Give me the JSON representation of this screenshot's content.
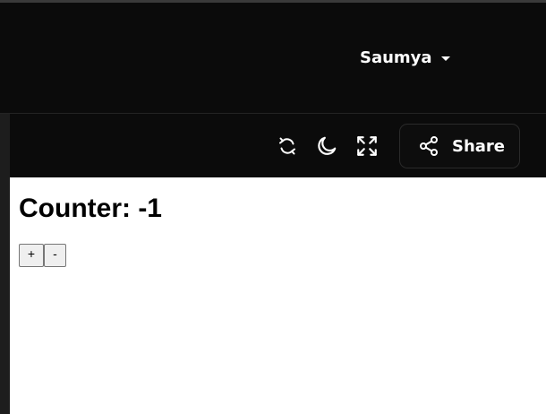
{
  "header": {
    "user_name": "Saumya"
  },
  "toolbar": {
    "icons": [
      "refresh-icon",
      "moon-icon",
      "fullscreen-icon"
    ],
    "share_label": "Share"
  },
  "app": {
    "counter_label": "Counter: -1",
    "increment_label": "+",
    "decrement_label": "-"
  },
  "colors": {
    "header_bg": "#0b0b0b",
    "text_light": "#ffffff",
    "content_bg": "#ffffff",
    "button_bg": "#efefef"
  }
}
